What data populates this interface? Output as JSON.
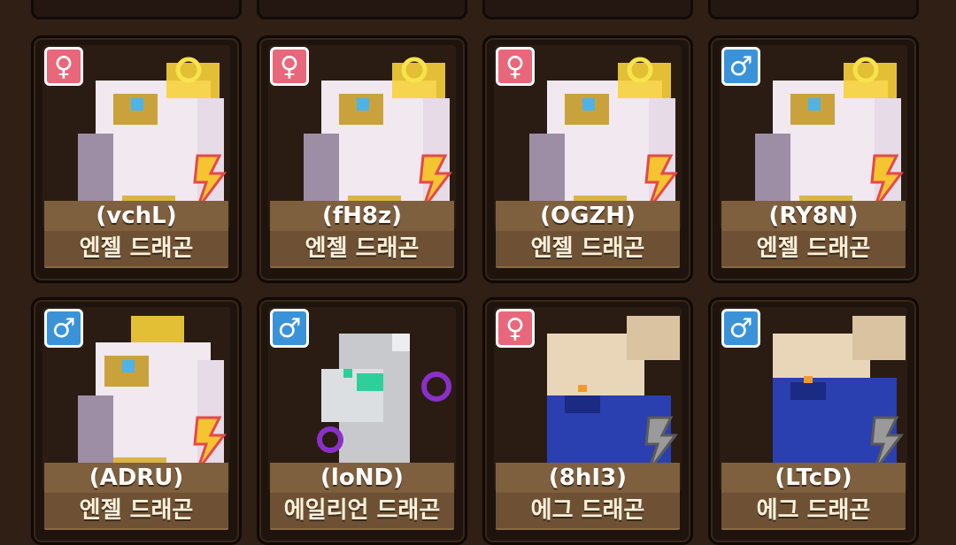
{
  "dragons": [
    {
      "gender": "female",
      "gender_symbol": "♀",
      "code": "(vchL)",
      "name": "엔젤 드래곤",
      "species": "angel",
      "element": "lightning"
    },
    {
      "gender": "female",
      "gender_symbol": "♀",
      "code": "(fH8z)",
      "name": "엔젤 드래곤",
      "species": "angel",
      "element": "lightning"
    },
    {
      "gender": "female",
      "gender_symbol": "♀",
      "code": "(OGZH)",
      "name": "엔젤 드래곤",
      "species": "angel",
      "element": "lightning"
    },
    {
      "gender": "male",
      "gender_symbol": "♂",
      "code": "(RY8N)",
      "name": "엔젤 드래곤",
      "species": "angel",
      "element": "lightning"
    },
    {
      "gender": "male",
      "gender_symbol": "♂",
      "code": "(ADRU)",
      "name": "엔젤 드래곤",
      "species": "angel",
      "element": "lightning"
    },
    {
      "gender": "male",
      "gender_symbol": "♂",
      "code": "(loND)",
      "name": "에일리언 드래곤",
      "species": "alien",
      "element": "void"
    },
    {
      "gender": "female",
      "gender_symbol": "♀",
      "code": "(8hI3)",
      "name": "에그 드래곤",
      "species": "egg",
      "element": "lightning-grey"
    },
    {
      "gender": "male",
      "gender_symbol": "♂",
      "code": "(LTcD)",
      "name": "에그 드래곤",
      "species": "egg",
      "element": "lightning-grey"
    }
  ],
  "colors": {
    "female_badge": "#e8677a",
    "male_badge": "#3a93d9",
    "plate": "#8a6a46",
    "background": "#2f1f14"
  }
}
